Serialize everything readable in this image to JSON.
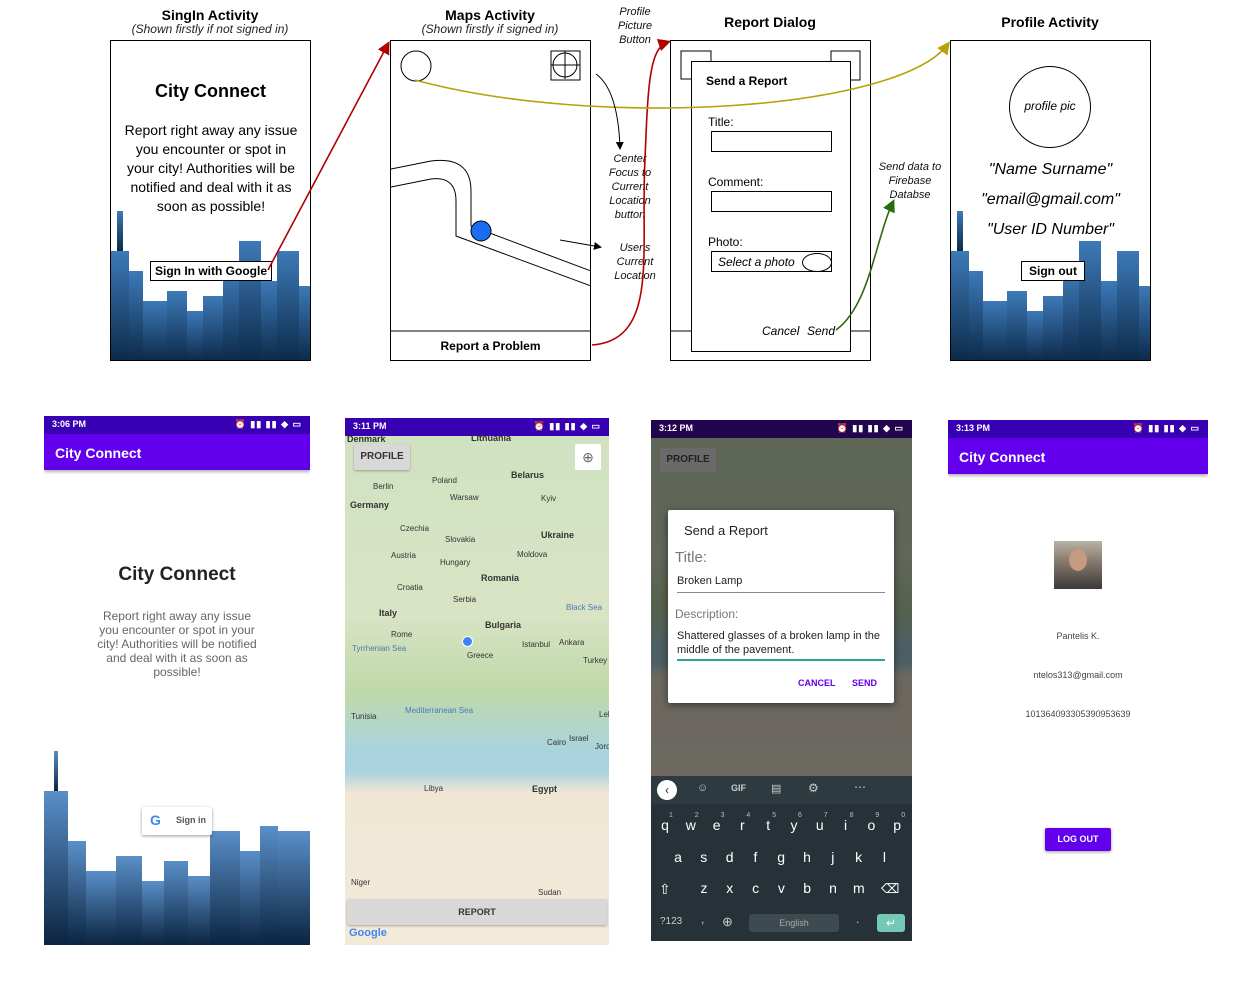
{
  "colors": {
    "primary": "#6200ee",
    "status_bar": "#3700b3",
    "arrow_red": "#b00000",
    "arrow_gold": "#b8a00a",
    "arrow_green": "#2a6a10",
    "accent_teal": "#2aa198"
  },
  "wireframes": {
    "signin": {
      "heading": "SingIn Activity",
      "subheading": "(Shown firstly if not signed in)",
      "app_title": "City Connect",
      "description": "Report right away any issue you encounter or spot in your city! Authorities will be notified and deal with it as soon as possible!",
      "button": "Sign In with Google"
    },
    "maps": {
      "heading": "Maps Activity",
      "subheading": "(Shown firstly if signed in)",
      "button": "Report a Problem",
      "note_profile": "Profile Picture Button",
      "note_center": "Center Focus to Current Location button",
      "note_location": "User's Current Location"
    },
    "report": {
      "heading": "Report Dialog",
      "dialog_title": "Send a Report",
      "title_label": "Title:",
      "comment_label": "Comment:",
      "photo_label": "Photo:",
      "photo_button": "Select a photo",
      "cancel": "Cancel",
      "send": "Send",
      "note_send": "Send data to Firebase Databse"
    },
    "profile": {
      "heading": "Profile Activity",
      "pic": "profile pic",
      "name": "\"Name Surname\"",
      "email": "\"email@gmail.com\"",
      "user_id": "\"User ID Number\"",
      "button": "Sign out"
    }
  },
  "screens": {
    "signin": {
      "time": "3:06 PM",
      "app_bar": "City Connect",
      "title": "City Connect",
      "description": "Report right away any issue you encounter or spot in your city! Authorities will be notified and deal with it as soon as possible!",
      "button": "Sign in"
    },
    "maps": {
      "time": "3:11 PM",
      "profile_button": "PROFILE",
      "report_button": "REPORT",
      "google": "Google",
      "labels": [
        "Denmark",
        "Lithuania",
        "Belarus",
        "Poland",
        "Berlin",
        "Warsaw",
        "Kyiv",
        "Germany",
        "Czechia",
        "Slovakia",
        "Ukraine",
        "Austria",
        "Hungary",
        "Moldova",
        "Croatia",
        "Romania",
        "Serbia",
        "Italy",
        "Bulgaria",
        "Black Sea",
        "Rome",
        "Tyrrhenian Sea",
        "Istanbul",
        "Ankara",
        "Greece",
        "Turkey",
        "Mediterranean Sea",
        "Tunisia",
        "Cairo",
        "Israel",
        "Jordan",
        "Lebanon",
        "Libya",
        "Egypt",
        "Niger",
        "Sudan"
      ]
    },
    "report": {
      "time": "3:12 PM",
      "dialog_title": "Send a Report",
      "title_label": "Title:",
      "title_value": "Broken Lamp",
      "description_label": "Description:",
      "description_value": "Shattered glasses of a broken lamp in the middle of the pavement.",
      "cancel": "CANCEL",
      "send": "SEND",
      "gif": "GIF",
      "sym": "?123",
      "space": "English",
      "comma": ",",
      "period": ".",
      "row1": [
        "q",
        "w",
        "e",
        "r",
        "t",
        "y",
        "u",
        "i",
        "o",
        "p"
      ],
      "row1_hints": [
        "1",
        "2",
        "3",
        "4",
        "5",
        "6",
        "7",
        "8",
        "9",
        "0"
      ],
      "row2": [
        "a",
        "s",
        "d",
        "f",
        "g",
        "h",
        "j",
        "k",
        "l"
      ],
      "row3": [
        "z",
        "x",
        "c",
        "v",
        "b",
        "n",
        "m"
      ]
    },
    "profile": {
      "time": "3:13 PM",
      "app_bar": "City Connect",
      "name": "Pantelis K.",
      "email": "ntelos313@gmail.com",
      "user_id": "101364093305390953639",
      "button": "LOG OUT"
    }
  }
}
